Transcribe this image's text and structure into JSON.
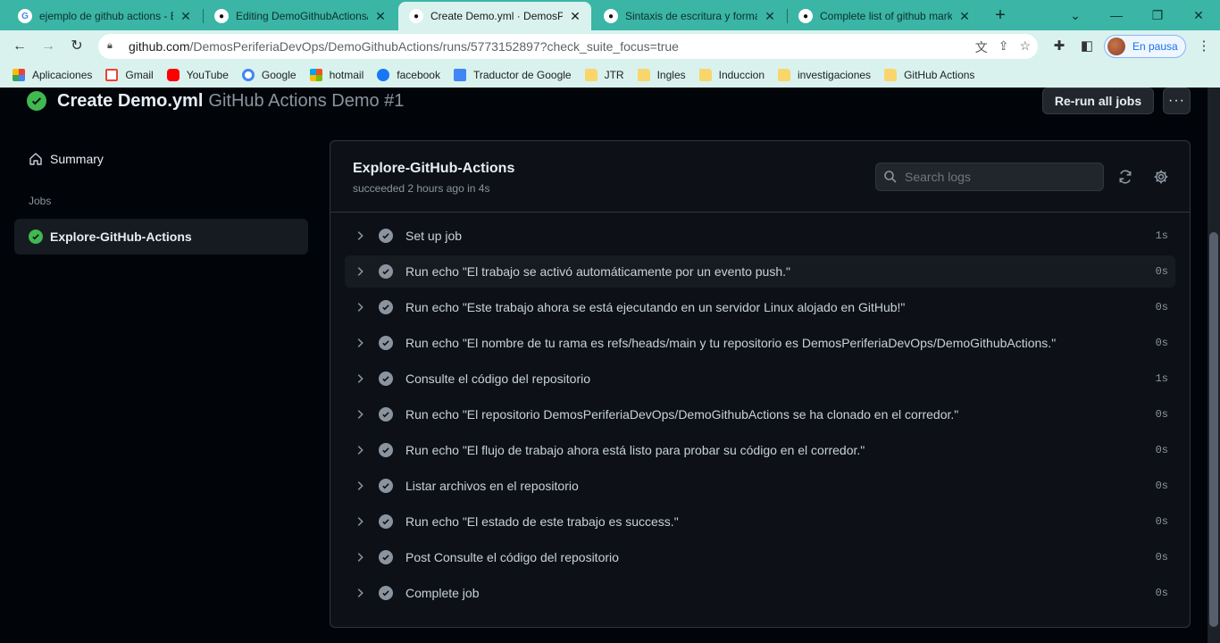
{
  "browser": {
    "tabs": [
      {
        "label": "ejemplo de github actions - B",
        "favicon": "google-icon"
      },
      {
        "label": "Editing DemoGithubActions/R",
        "favicon": "github-icon"
      },
      {
        "label": "Create Demo.yml · DemosPer",
        "favicon": "github-icon",
        "active": true
      },
      {
        "label": "Sintaxis de escritura y formato",
        "favicon": "github-icon"
      },
      {
        "label": "Complete list of github mark",
        "favicon": "github-icon"
      }
    ],
    "url_host": "github.com",
    "url_path": "/DemosPeriferiaDevOps/DemoGithubActions/runs/5773152897?check_suite_focus=true",
    "profile_label": "En pausa",
    "bookmarks": [
      "Aplicaciones",
      "Gmail",
      "YouTube",
      "Google",
      "hotmail",
      "facebook",
      "Traductor de Google",
      "JTR",
      "Ingles",
      "Induccion",
      "investigaciones",
      "GitHub Actions"
    ]
  },
  "run": {
    "title": "Create Demo.yml",
    "subtitle": "GitHub Actions Demo #1",
    "rerun_label": "Re-run all jobs",
    "more_label": "···",
    "status_color": "#3fb950"
  },
  "sidebar": {
    "summary_label": "Summary",
    "jobs_label": "Jobs",
    "job_label": "Explore-GitHub-Actions"
  },
  "job": {
    "title": "Explore-GitHub-Actions",
    "meta": "succeeded 2 hours ago in 4s",
    "search_placeholder": "Search logs",
    "steps": [
      {
        "name": "Set up job",
        "duration": "1s"
      },
      {
        "name": "Run echo \"El trabajo se activó automáticamente por un evento push.\"",
        "duration": "0s"
      },
      {
        "name": "Run echo \"Este trabajo ahora se está ejecutando en un servidor Linux alojado en GitHub!\"",
        "duration": "0s"
      },
      {
        "name": "Run echo \"El nombre de tu rama es refs/heads/main y tu repositorio es DemosPeriferiaDevOps/DemoGithubActions.\"",
        "duration": "0s"
      },
      {
        "name": "Consulte el código del repositorio",
        "duration": "1s"
      },
      {
        "name": "Run echo \"El repositorio DemosPeriferiaDevOps/DemoGithubActions se ha clonado en el corredor.\"",
        "duration": "0s"
      },
      {
        "name": "Run echo \"El flujo de trabajo ahora está listo para probar su código en el corredor.\"",
        "duration": "0s"
      },
      {
        "name": "Listar archivos en el repositorio",
        "duration": "0s"
      },
      {
        "name": "Run echo \"El estado de este trabajo es success.\"",
        "duration": "0s"
      },
      {
        "name": "Post Consulte el código del repositorio",
        "duration": "0s"
      },
      {
        "name": "Complete job",
        "duration": "0s"
      }
    ]
  }
}
